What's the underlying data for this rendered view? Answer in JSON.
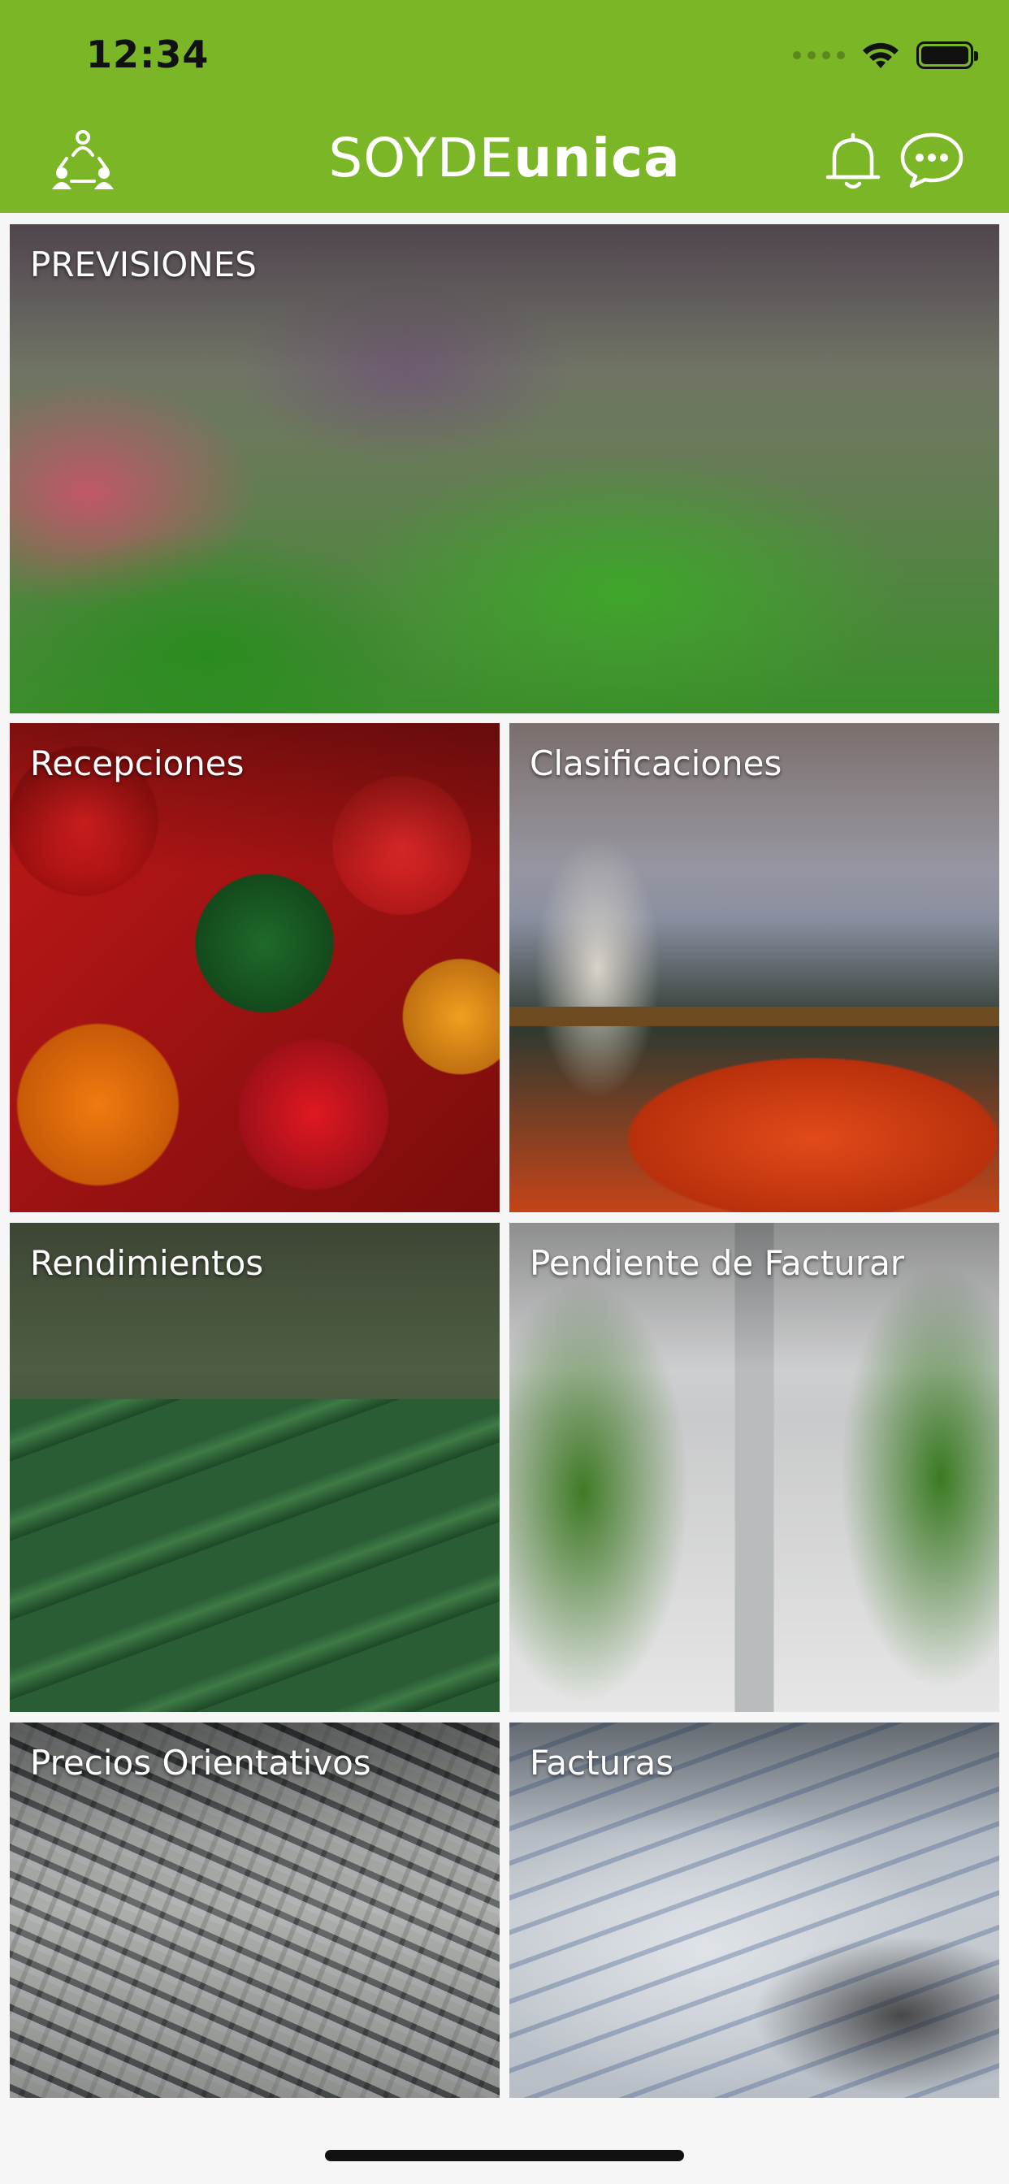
{
  "status_bar": {
    "time": "12:34"
  },
  "header": {
    "logo_part1": "SOYDE",
    "logo_part2": "unica",
    "left_icon": "users-network-icon",
    "right_icons": [
      "bell-icon",
      "chat-bubble-icon"
    ]
  },
  "colors": {
    "brand_green": "#7ab626",
    "tile_title": "#ffffff"
  },
  "tiles": [
    {
      "label": "PREVISIONES"
    },
    {
      "label": "Recepciones"
    },
    {
      "label": "Clasificaciones"
    },
    {
      "label": "Rendimientos"
    },
    {
      "label": "Pendiente de Facturar"
    },
    {
      "label": "Precios Orientativos"
    },
    {
      "label": "Facturas"
    }
  ]
}
